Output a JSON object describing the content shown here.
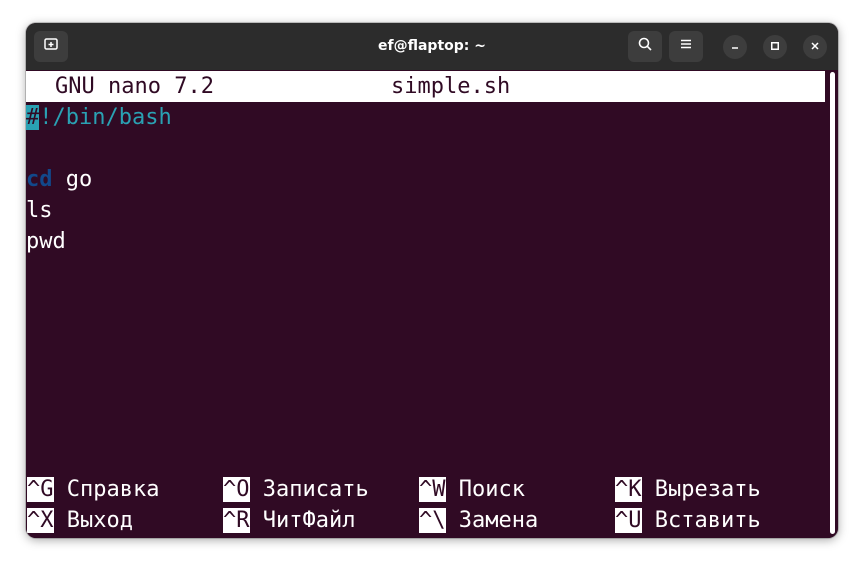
{
  "window": {
    "title": "ef@flaptop: ~",
    "icons": {
      "new_tab": "new-tab-icon",
      "search": "search-icon",
      "menu": "hamburger-menu-icon",
      "minimize": "minimize-icon",
      "maximize": "maximize-icon",
      "close": "close-icon"
    }
  },
  "nano": {
    "version": "GNU nano 7.2",
    "filename": "simple.sh",
    "lines": {
      "shebang_hash": "#",
      "shebang_rest": "!/bin/bash",
      "line3_keyword": "cd",
      "line3_rest": " go",
      "line4": "ls",
      "line5": "pwd"
    },
    "shortcuts": [
      {
        "key": "^G",
        "label": "Справка"
      },
      {
        "key": "^O",
        "label": "Записать"
      },
      {
        "key": "^W",
        "label": "Поиск"
      },
      {
        "key": "^K",
        "label": "Вырезать"
      },
      {
        "key": "^X",
        "label": "Выход"
      },
      {
        "key": "^R",
        "label": "ЧитФайл"
      },
      {
        "key": "^\\",
        "label": "Замена"
      },
      {
        "key": "^U",
        "label": "Вставить"
      }
    ]
  },
  "colors": {
    "terminal_bg": "#300a24",
    "cursor": "#2aa1b3",
    "keyword": "#12488b",
    "titlebar": "#2c2c2c"
  }
}
